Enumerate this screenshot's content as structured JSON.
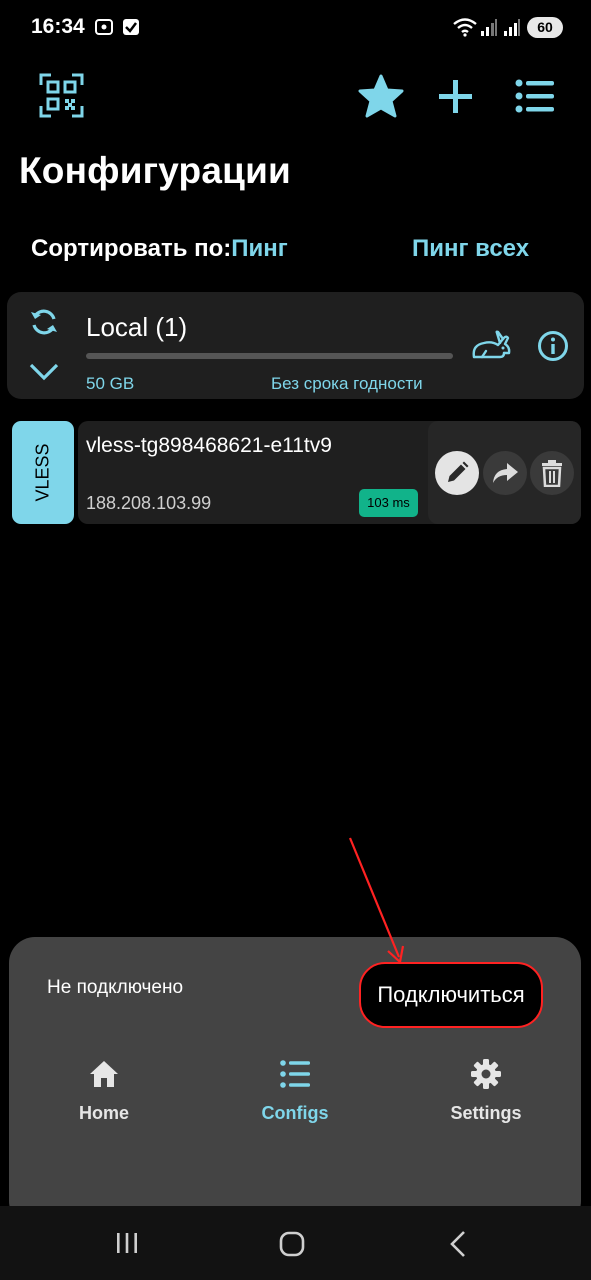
{
  "status_bar": {
    "time": "16:34",
    "battery": "60"
  },
  "toolbar": {
    "icons": [
      "qr-code-scan-icon",
      "star-icon",
      "plus-icon",
      "list-icon"
    ]
  },
  "page": {
    "title": "Конфигурации"
  },
  "sort": {
    "label": "Сортировать по:",
    "value": "Пинг",
    "ping_all_label": "Пинг всех"
  },
  "subscription": {
    "name": "Local (1)",
    "traffic": "50 GB",
    "expiry": "Без срока годности",
    "usage_fraction": 0.0
  },
  "configs": [
    {
      "protocol": "VLESS",
      "name": "vless-tg898468621-e11tv9",
      "address": "188.208.103.99",
      "ping": "103 ms"
    }
  ],
  "connection": {
    "status": "Не подключено",
    "connect_label": "Подключиться"
  },
  "bottom_nav": {
    "home": "Home",
    "configs": "Configs",
    "settings": "Settings"
  },
  "colors": {
    "accent": "#7fd6ea",
    "ping_badge": "#11b38a",
    "annotation": "#ff2222",
    "background": "#000000",
    "panel": "#444444"
  }
}
